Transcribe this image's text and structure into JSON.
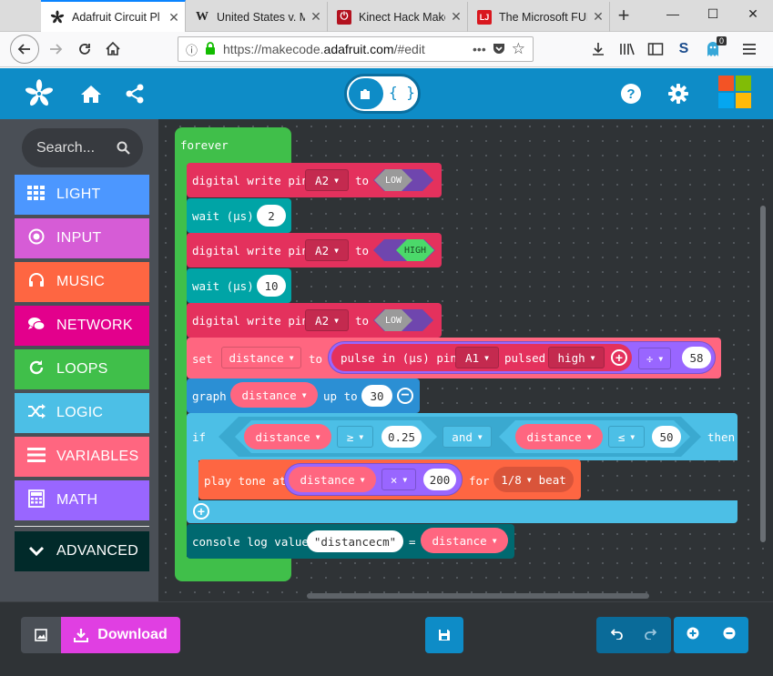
{
  "browser": {
    "tabs": [
      {
        "title": "Adafruit Circuit Pl",
        "active": true,
        "favicon": "adafruit-icon"
      },
      {
        "title": "United States v. M",
        "active": false,
        "favicon": "wikipedia-icon",
        "favtext": "W"
      },
      {
        "title": "Kinect Hack Make",
        "active": false,
        "favicon": "power-icon"
      },
      {
        "title": "The Microsoft FUD",
        "active": false,
        "favicon": "lj-icon",
        "favtext": "LJ"
      }
    ],
    "url_prefix": "https://makecode.",
    "url_host": "adafruit.com",
    "url_suffix": "/#edit",
    "badge": "0",
    "s_icon": "S"
  },
  "toolbox": {
    "search_placeholder": "Search...",
    "categories": [
      {
        "label": "LIGHT",
        "color": "#4c97ff",
        "icon": "grid-icon"
      },
      {
        "label": "INPUT",
        "color": "#d65cd6",
        "icon": "target-icon"
      },
      {
        "label": "MUSIC",
        "color": "#fe6642",
        "icon": "headphones-icon"
      },
      {
        "label": "NETWORK",
        "color": "#e3008c",
        "icon": "chat-icon"
      },
      {
        "label": "LOOPS",
        "color": "#40bf4a",
        "icon": "refresh-icon"
      },
      {
        "label": "LOGIC",
        "color": "#4cbfe6",
        "icon": "shuffle-icon"
      },
      {
        "label": "VARIABLES",
        "color": "#ff6680",
        "icon": "list-icon"
      },
      {
        "label": "MATH",
        "color": "#9966ff",
        "icon": "calculator-icon"
      }
    ],
    "advanced": "ADVANCED"
  },
  "blocks": {
    "forever": "forever",
    "dw1": {
      "label": "digital write pin",
      "pin": "A2",
      "to": "to",
      "value": "LOW"
    },
    "wait1": {
      "label": "wait (µs)",
      "value": "2"
    },
    "dw2": {
      "label": "digital write pin",
      "pin": "A2",
      "to": "to",
      "value": "HIGH"
    },
    "wait2": {
      "label": "wait (µs)",
      "value": "10"
    },
    "dw3": {
      "label": "digital write pin",
      "pin": "A2",
      "to": "to",
      "value": "LOW"
    },
    "set": {
      "label": "set",
      "var": "distance",
      "to": "to",
      "pulse_label": "pulse in (µs) pin",
      "pin": "A1",
      "pulsed": "pulsed",
      "level": "high",
      "op": "÷",
      "divisor": "58"
    },
    "graph": {
      "label": "graph",
      "var": "distance",
      "up_to": "up to",
      "value": "30"
    },
    "if": {
      "label": "if",
      "var1": "distance",
      "op1": "≥",
      "v1": "0.25",
      "and": "and",
      "var2": "distance",
      "op2": "≤",
      "v2": "50",
      "then": "then"
    },
    "tone": {
      "label": "play tone at",
      "var": "distance",
      "op": "×",
      "value": "200",
      "for": "for",
      "beat_value": "1/8",
      "beat": "beat"
    },
    "console": {
      "label": "console log value",
      "key": "\"distancecm\"",
      "eq": "=",
      "var": "distance"
    }
  },
  "bottom": {
    "download": "Download"
  }
}
